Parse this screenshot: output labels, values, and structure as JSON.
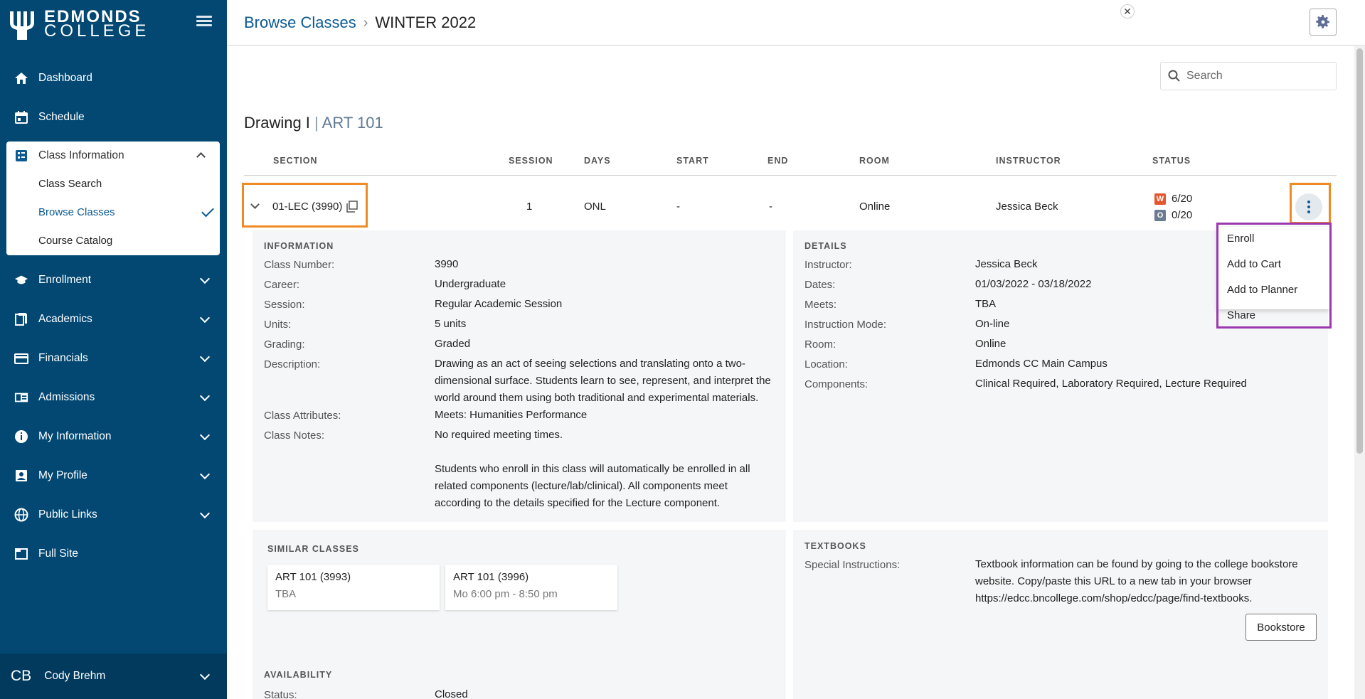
{
  "sidebar": {
    "logo_line1": "EDMONDS",
    "logo_line2": "COLLEGE",
    "items": [
      {
        "label": "Dashboard",
        "icon": "home-icon"
      },
      {
        "label": "Schedule",
        "icon": "calendar-icon"
      },
      {
        "label": "Enrollment",
        "icon": "graduation-cap-icon"
      },
      {
        "label": "Academics",
        "icon": "documents-icon"
      },
      {
        "label": "Financials",
        "icon": "credit-card-icon"
      },
      {
        "label": "Admissions",
        "icon": "id-card-icon"
      },
      {
        "label": "My Information",
        "icon": "info-icon"
      },
      {
        "label": "My Profile",
        "icon": "profile-icon"
      },
      {
        "label": "Public Links",
        "icon": "globe-icon"
      },
      {
        "label": "Full Site",
        "icon": "window-icon"
      }
    ],
    "class_info": {
      "label": "Class Information",
      "sub": [
        "Class Search",
        "Browse Classes",
        "Course Catalog"
      ],
      "active": "Browse Classes"
    },
    "user": {
      "initials": "CB",
      "name": "Cody Brehm"
    }
  },
  "header": {
    "breadcrumb_link": "Browse Classes",
    "breadcrumb_sep": "›",
    "breadcrumb_current": "WINTER 2022"
  },
  "search": {
    "placeholder": "Search"
  },
  "course": {
    "name": "Drawing I",
    "pipe": "|",
    "code": "ART 101"
  },
  "columns": [
    "SECTION",
    "SESSION",
    "DAYS",
    "START",
    "END",
    "ROOM",
    "INSTRUCTOR",
    "STATUS"
  ],
  "section_row": {
    "section": "01-LEC (3990)",
    "session": "1",
    "days": "ONL",
    "start": "-",
    "end": "-",
    "room": "Online",
    "instructor": "Jessica Beck",
    "status_w_letter": "W",
    "status_w": "6/20",
    "status_o_letter": "O",
    "status_o": "0/20"
  },
  "menu": [
    "Enroll",
    "Add to Cart",
    "Add to Planner",
    "Share"
  ],
  "information": {
    "title": "INFORMATION",
    "labels": [
      "Class Number:",
      "Career:",
      "Session:",
      "Units:",
      "Grading:",
      "Description:",
      "Class Attributes:",
      "Class Notes:"
    ],
    "class_number": "3990",
    "career": "Undergraduate",
    "session": "Regular Academic Session",
    "units": "5 units",
    "grading": "Graded",
    "description_lines": [
      "Drawing as an act of seeing selections and translating onto a two-",
      "dimensional surface. Students learn to see, represent, and interpret the",
      "world around them using both traditional and experimental materials."
    ],
    "attributes": "Meets: Humanities Performance",
    "notes_line1": "No required meeting times.",
    "notes_lines": [
      "Students who enroll in this class will automatically be enrolled in all",
      "related components (lecture/lab/clinical). All components meet",
      "according to the details specified for the Lecture component."
    ]
  },
  "details": {
    "title": "DETAILS",
    "labels": [
      "Instructor:",
      "Dates:",
      "Meets:",
      "Instruction Mode:",
      "Room:",
      "Location:",
      "Components:"
    ],
    "values": [
      "Jessica Beck",
      "01/03/2022 - 03/18/2022",
      "TBA",
      "On-line",
      "Online",
      "Edmonds CC Main Campus",
      "Clinical Required, Laboratory Required, Lecture Required"
    ]
  },
  "similar": {
    "title": "SIMILAR CLASSES",
    "cards": [
      {
        "name": "ART 101 (3993)",
        "time": "TBA"
      },
      {
        "name": "ART 101 (3996)",
        "time": "Mo 6:00 pm - 8:50 pm"
      }
    ]
  },
  "textbooks": {
    "title": "TEXTBOOKS",
    "label": "Special Instructions:",
    "lines": [
      "Textbook information can be found by going to the college bookstore",
      "website. Copy/paste this URL to a new tab in your browser",
      "https://edcc.bncollege.com/shop/edcc/page/find-textbooks."
    ],
    "button": "Bookstore"
  },
  "availability": {
    "title": "AVAILABILITY",
    "label": "Status:",
    "value": "Closed"
  },
  "colors": {
    "sidebar": "#024873",
    "accent": "#0b5a92",
    "highlight_orange": "#f08a24",
    "highlight_purple": "#9b38b0"
  }
}
